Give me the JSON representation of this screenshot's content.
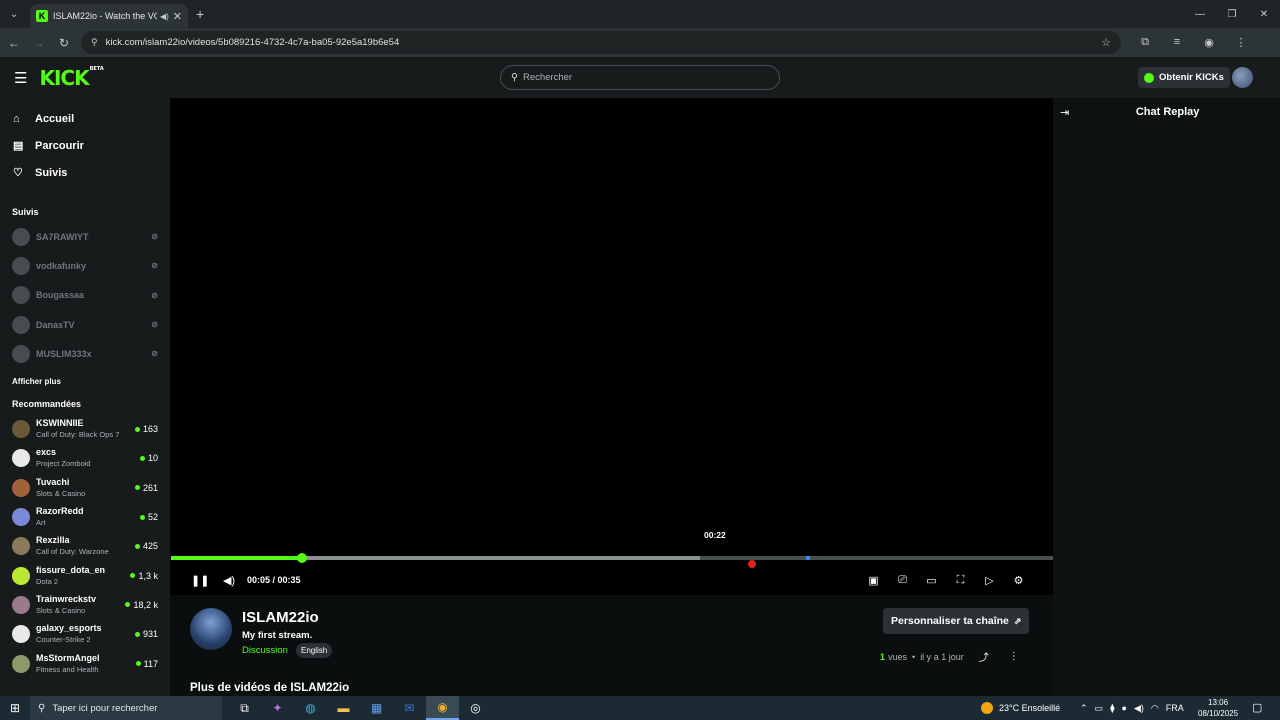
{
  "browser": {
    "tab_title": "ISLAM22io - Watch the VO",
    "tab_favicon": "K",
    "url": "kick.com/islam22io/videos/5b089216-4732-4c7a-ba05-92e5a19b6e54"
  },
  "header": {
    "logo": "KICK",
    "logo_badge": "BETA",
    "search_placeholder": "Rechercher",
    "kicks_button": "Obtenir KICKs"
  },
  "sidebar": {
    "nav": [
      {
        "label": "Accueil",
        "icon": "home-icon"
      },
      {
        "label": "Parcourir",
        "icon": "browse-icon"
      },
      {
        "label": "Suivis",
        "icon": "heart-icon"
      }
    ],
    "following_title": "Suivis",
    "following": [
      {
        "name": "SA7RAWIYT"
      },
      {
        "name": "vodkafunky"
      },
      {
        "name": "Bougassaa"
      },
      {
        "name": "DanasTV"
      },
      {
        "name": "MUSLIM333x"
      }
    ],
    "show_more": "Afficher plus",
    "recommended_title": "Recommandées",
    "recommended": [
      {
        "name": "KSWINNIIE",
        "category": "Call of Duty: Black Ops 7",
        "viewers": "163",
        "color": "#6b5a3a"
      },
      {
        "name": "excs",
        "category": "Project Zomboid",
        "viewers": "10",
        "color": "#e8e8e8"
      },
      {
        "name": "Tuvachi",
        "category": "Slots & Casino",
        "viewers": "261",
        "color": "#a0603a"
      },
      {
        "name": "RazorRedd",
        "category": "Art",
        "viewers": "52",
        "color": "#7a8ad8"
      },
      {
        "name": "Rexzilla",
        "category": "Call of Duty: Warzone",
        "viewers": "425",
        "color": "#8a7a5a"
      },
      {
        "name": "fissure_dota_en",
        "category": "Dota 2",
        "viewers": "1,3 k",
        "color": "#b8e830"
      },
      {
        "name": "Trainwreckstv",
        "category": "Slots & Casino",
        "viewers": "18,2 k",
        "color": "#9a7a8a"
      },
      {
        "name": "galaxy_esports",
        "category": "Counter-Strike 2",
        "viewers": "931",
        "color": "#e8e8e8"
      },
      {
        "name": "MsStormAngel",
        "category": "Fitness and Health",
        "viewers": "117",
        "color": "#8a9a6a"
      }
    ]
  },
  "player": {
    "hover_time": "00:22",
    "time_display": "00:05 / 00:35",
    "progress_fraction": 0.148,
    "buffered_fraction": 0.6
  },
  "chat": {
    "title": "Chat Replay"
  },
  "channel": {
    "name": "ISLAM22io",
    "stream_title": "My first stream.",
    "category": "Discussion",
    "language": "English",
    "customize_button": "Personnaliser ta chaîne",
    "views_count": "1",
    "views_label": "vues",
    "age": "il y a 1 jour",
    "more_videos": "Plus de vidéos de ISLAM22io"
  },
  "taskbar": {
    "search_placeholder": "Taper ici pour rechercher",
    "weather": "23°C  Ensoleillé",
    "lang": "FRA",
    "time": "13:06",
    "date": "08/10/2025"
  },
  "colors": {
    "accent": "#53fc18",
    "background": "#0b0e0f",
    "sidebar": "#181b1c"
  }
}
